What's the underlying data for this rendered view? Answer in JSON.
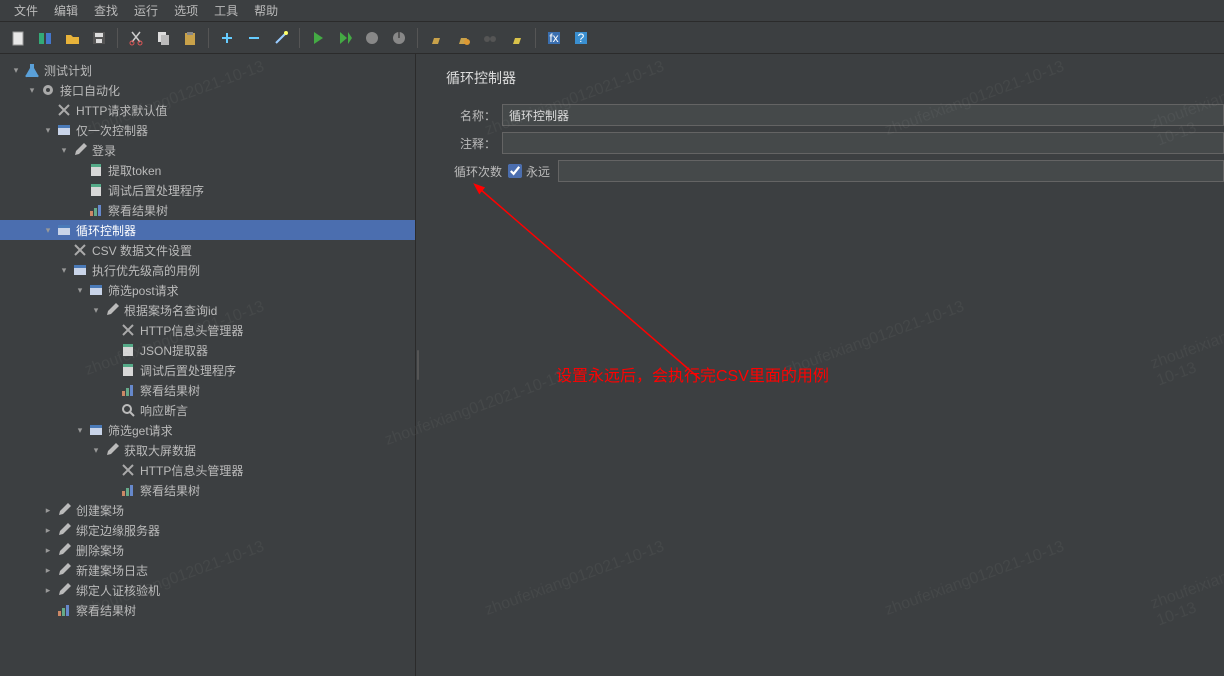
{
  "menu": [
    "文件",
    "编辑",
    "查找",
    "运行",
    "选项",
    "工具",
    "帮助"
  ],
  "toolbar_icons": [
    "new-file",
    "templates",
    "open",
    "save",
    "",
    "cut",
    "copy",
    "paste",
    "",
    "plus",
    "minus",
    "wand",
    "",
    "play",
    "play-no-pause",
    "stop",
    "shutdown",
    "",
    "broom-clear",
    "broom-warn",
    "binoculars",
    "broom-reset",
    "",
    "function",
    "help"
  ],
  "panel": {
    "title": "循环控制器",
    "name_label": "名称：",
    "name_value": "循环控制器",
    "comment_label": "注释：",
    "comment_value": "",
    "loop_label": "循环次数",
    "forever_label": "永远",
    "forever_checked": true
  },
  "annotation": "设置永远后，会执行完CSV里面的用例",
  "watermark_text": "zhoufeixiang012021-10-13",
  "tree": [
    {
      "d": 0,
      "t": "flask",
      "l": "测试计划",
      "e": "o"
    },
    {
      "d": 1,
      "t": "gear",
      "l": "接口自动化",
      "e": "o"
    },
    {
      "d": 2,
      "t": "x",
      "l": "HTTP请求默认值",
      "e": ""
    },
    {
      "d": 2,
      "t": "ctrl",
      "l": "仅一次控制器",
      "e": "o"
    },
    {
      "d": 3,
      "t": "pencil",
      "l": "登录",
      "e": "o"
    },
    {
      "d": 4,
      "t": "doc",
      "l": "提取token",
      "e": ""
    },
    {
      "d": 4,
      "t": "doc",
      "l": "调试后置处理程序",
      "e": ""
    },
    {
      "d": 4,
      "t": "chart",
      "l": "察看结果树",
      "e": ""
    },
    {
      "d": 2,
      "t": "ctrl",
      "l": "循环控制器",
      "e": "o",
      "sel": true
    },
    {
      "d": 3,
      "t": "x",
      "l": "CSV 数据文件设置",
      "e": ""
    },
    {
      "d": 3,
      "t": "ctrl",
      "l": "执行优先级高的用例",
      "e": "o"
    },
    {
      "d": 4,
      "t": "ctrl",
      "l": "筛选post请求",
      "e": "o"
    },
    {
      "d": 5,
      "t": "pencil",
      "l": "根据案场名查询id",
      "e": "o"
    },
    {
      "d": 6,
      "t": "x",
      "l": "HTTP信息头管理器",
      "e": ""
    },
    {
      "d": 6,
      "t": "doc",
      "l": "JSON提取器",
      "e": ""
    },
    {
      "d": 6,
      "t": "doc",
      "l": "调试后置处理程序",
      "e": ""
    },
    {
      "d": 6,
      "t": "chart",
      "l": "察看结果树",
      "e": ""
    },
    {
      "d": 6,
      "t": "mag",
      "l": "响应断言",
      "e": ""
    },
    {
      "d": 4,
      "t": "ctrl",
      "l": "筛选get请求",
      "e": "o"
    },
    {
      "d": 5,
      "t": "pencil",
      "l": "获取大屏数据",
      "e": "o"
    },
    {
      "d": 6,
      "t": "x",
      "l": "HTTP信息头管理器",
      "e": ""
    },
    {
      "d": 6,
      "t": "chart",
      "l": "察看结果树",
      "e": ""
    },
    {
      "d": 2,
      "t": "pencil",
      "l": "创建案场",
      "e": "c"
    },
    {
      "d": 2,
      "t": "pencil",
      "l": "绑定边缘服务器",
      "e": "c"
    },
    {
      "d": 2,
      "t": "pencil",
      "l": "删除案场",
      "e": "c"
    },
    {
      "d": 2,
      "t": "pencil",
      "l": "新建案场日志",
      "e": "c"
    },
    {
      "d": 2,
      "t": "pencil",
      "l": "绑定人证核验机",
      "e": "c"
    },
    {
      "d": 2,
      "t": "chart",
      "l": "察看结果树",
      "e": ""
    }
  ]
}
